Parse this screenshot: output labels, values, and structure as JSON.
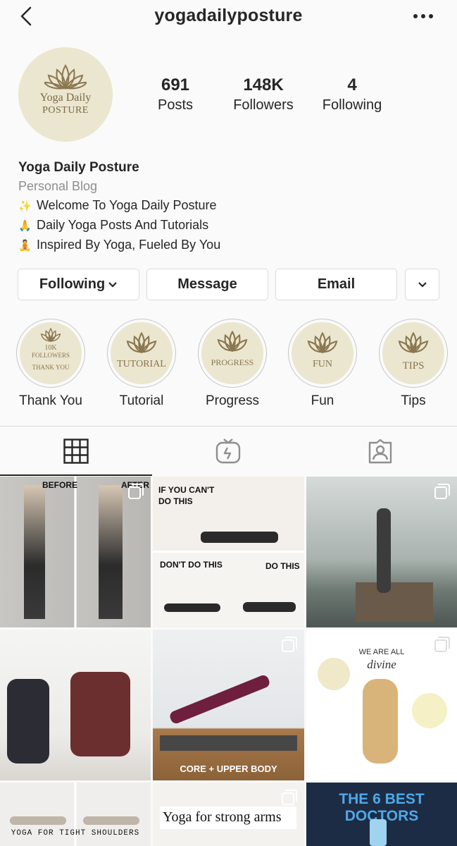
{
  "header": {
    "username": "yogadailyposture"
  },
  "profile": {
    "avatar_text_line1": "Yoga Daily",
    "avatar_text_line2": "Posture",
    "stats": [
      {
        "value": "691",
        "label": "Posts"
      },
      {
        "value": "148K",
        "label": "Followers"
      },
      {
        "value": "4",
        "label": "Following"
      }
    ],
    "name": "Yoga Daily Posture",
    "category": "Personal Blog",
    "bio_lines": [
      {
        "emoji": "✨",
        "text": "Welcome To Yoga Daily Posture"
      },
      {
        "emoji": "🙏",
        "text": "Daily Yoga Posts And Tutorials"
      },
      {
        "emoji": "🧘",
        "text": "Inspired By Yoga, Fueled By You"
      }
    ]
  },
  "actions": {
    "following": "Following",
    "message": "Message",
    "email": "Email"
  },
  "highlights": [
    {
      "label": "Thank You",
      "cover_lines": [
        "10K",
        "FOLLOWERS",
        "THANK YOU"
      ]
    },
    {
      "label": "Tutorial",
      "cover_lines": [
        "Tutorial"
      ]
    },
    {
      "label": "Progress",
      "cover_lines": [
        "Progress"
      ]
    },
    {
      "label": "Fun",
      "cover_lines": [
        "Fun"
      ]
    },
    {
      "label": "Tips",
      "cover_lines": [
        "Tips"
      ]
    }
  ],
  "tabs": [
    {
      "name": "grid",
      "icon": "grid-icon",
      "active": true
    },
    {
      "name": "igtv",
      "icon": "igtv-icon",
      "active": false
    },
    {
      "name": "tagged",
      "icon": "tagged-icon",
      "active": false
    }
  ],
  "posts": [
    {
      "overlay": [
        "BEFORE",
        "AFTER"
      ]
    },
    {
      "overlay": [
        "IF YOU CAN'T",
        "DO THIS",
        "DON'T DO THIS",
        "DO THIS"
      ]
    },
    {
      "overlay": []
    },
    {
      "overlay": []
    },
    {
      "overlay": [
        "CORE + UPPER BODY"
      ]
    },
    {
      "overlay": [
        "WE ARE ALL",
        "divine"
      ]
    },
    {
      "overlay": [
        "YOGA FOR TIGHT SHOULDERS"
      ]
    },
    {
      "overlay": [
        "Yoga for strong arms"
      ]
    },
    {
      "overlay": [
        "THE 6 BEST DOCTORS"
      ]
    }
  ],
  "colors": {
    "text": "#262626",
    "muted": "#8e8e8e",
    "border": "#dbdbdb",
    "logo_bg": "#ebe6cf",
    "logo_gold": "#8a7650"
  }
}
